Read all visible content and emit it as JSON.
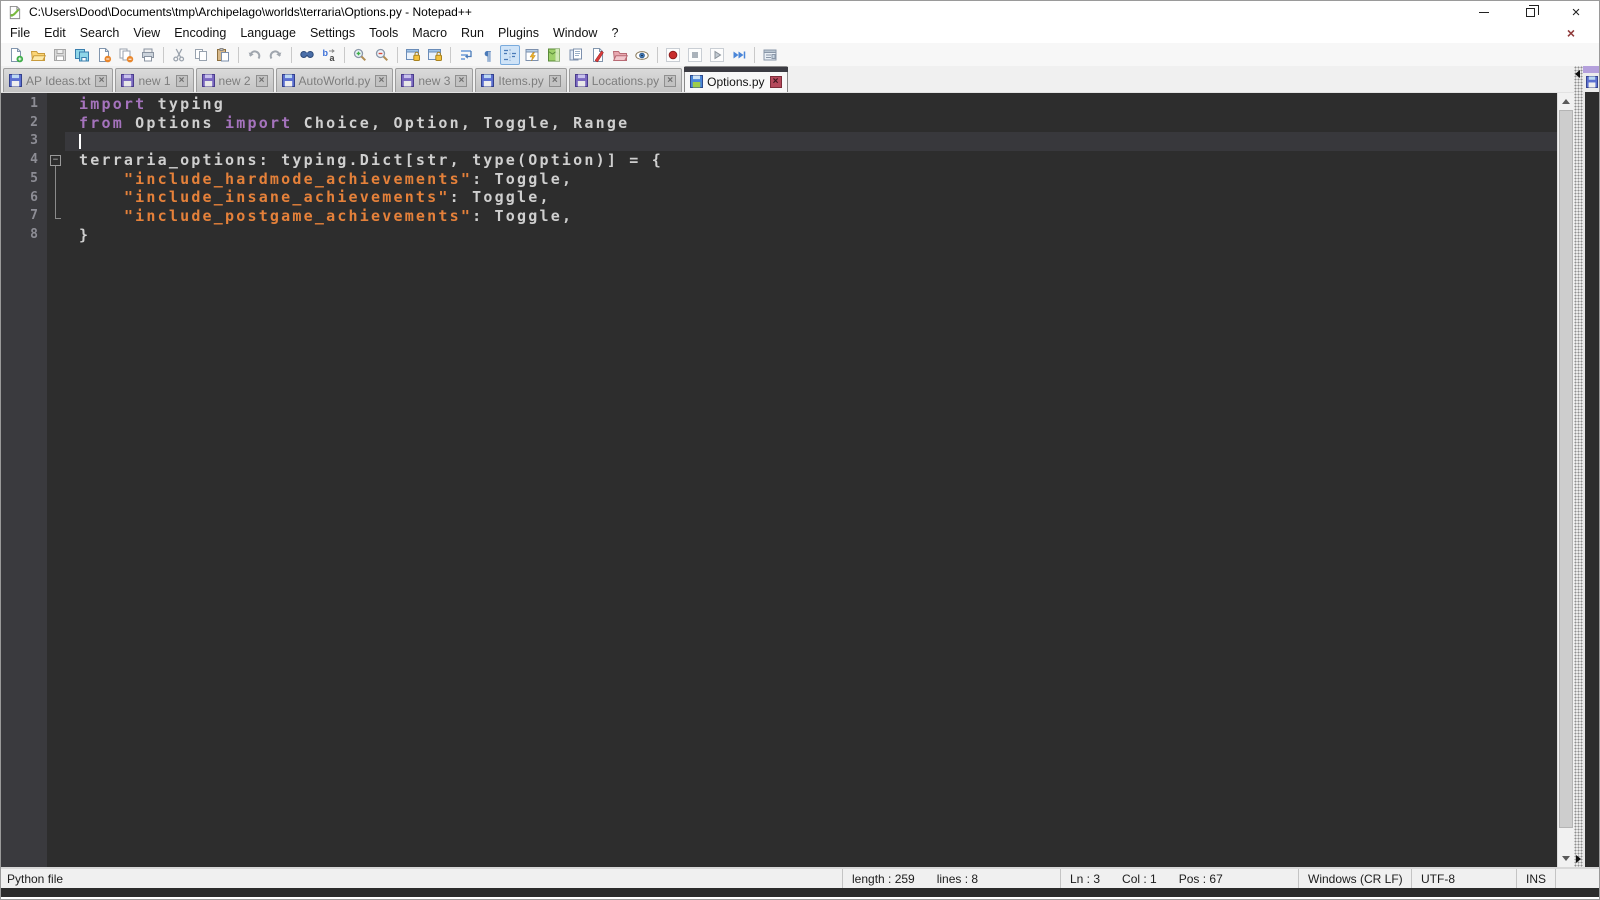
{
  "window": {
    "title": "C:\\Users\\Dood\\Documents\\tmp\\Archipelago\\worlds\\terraria\\Options.py - Notepad++",
    "controls": [
      "minimize",
      "restore",
      "close"
    ]
  },
  "menu": {
    "items": [
      "File",
      "Edit",
      "Search",
      "View",
      "Encoding",
      "Language",
      "Settings",
      "Tools",
      "Macro",
      "Run",
      "Plugins",
      "Window",
      "?"
    ],
    "doc_close_x": "×"
  },
  "toolbar": {
    "items": [
      "new-file",
      "open-file",
      "save-file",
      "save-all",
      "close-file",
      "close-all",
      "print",
      "sep",
      "cut",
      "copy",
      "paste",
      "sep",
      "undo",
      "redo",
      "sep",
      "find",
      "replace",
      "sep",
      "zoom-in",
      "zoom-out",
      "sep",
      "sync-vertical-scroll",
      "sync-horizontal-scroll",
      "sep",
      "word-wrap",
      "show-all-characters",
      "indent-guide",
      "function-list",
      "document-map",
      "document-list",
      "monitoring",
      "project-panel",
      "view-file",
      "sep",
      "macro-record",
      "macro-stop",
      "macro-play",
      "macro-run-multiple",
      "sep",
      "settings-panel"
    ],
    "pressed": [
      "indent-guide"
    ]
  },
  "tabs": [
    {
      "label": "AP Ideas.txt",
      "active": false,
      "icon": "blue"
    },
    {
      "label": "new 1",
      "active": false,
      "icon": "purple"
    },
    {
      "label": "new 2",
      "active": false,
      "icon": "purple"
    },
    {
      "label": "AutoWorld.py",
      "active": false,
      "icon": "blue"
    },
    {
      "label": "new 3",
      "active": false,
      "icon": "purple"
    },
    {
      "label": "Items.py",
      "active": false,
      "icon": "blue"
    },
    {
      "label": "Locations.py",
      "active": false,
      "icon": "purple"
    },
    {
      "label": "Options.py",
      "active": true,
      "icon": "green"
    }
  ],
  "editor": {
    "current_line": 3,
    "caret": {
      "line": 3,
      "col": 1
    },
    "lines": [
      {
        "num": "1",
        "fold": "",
        "segs": [
          [
            "kw",
            "import"
          ],
          [
            "df",
            " typing"
          ]
        ]
      },
      {
        "num": "2",
        "fold": "",
        "segs": [
          [
            "kw",
            "from"
          ],
          [
            "df",
            " Options "
          ],
          [
            "kw",
            "import"
          ],
          [
            "df",
            " Choice, Option, Toggle, Range"
          ]
        ]
      },
      {
        "num": "3",
        "fold": "",
        "segs": []
      },
      {
        "num": "4",
        "fold": "start",
        "segs": [
          [
            "df",
            "terraria_options: typing.Dict[str, type(Option)] = {"
          ]
        ]
      },
      {
        "num": "5",
        "fold": "mid",
        "segs": [
          [
            "df",
            "    "
          ],
          [
            "st",
            "\"include_hardmode_achievements\""
          ],
          [
            "df",
            ": Toggle,"
          ]
        ]
      },
      {
        "num": "6",
        "fold": "mid",
        "segs": [
          [
            "df",
            "    "
          ],
          [
            "st",
            "\"include_insane_achievements\""
          ],
          [
            "df",
            ": Toggle,"
          ]
        ]
      },
      {
        "num": "7",
        "fold": "end",
        "segs": [
          [
            "df",
            "    "
          ],
          [
            "st",
            "\"include_postgame_achievements\""
          ],
          [
            "df",
            ": Toggle,"
          ]
        ]
      },
      {
        "num": "8",
        "fold": "",
        "segs": [
          [
            "df",
            "}"
          ]
        ]
      }
    ],
    "colors": {
      "background": "#2d2d2d",
      "gutter_background": "#3a3a3e",
      "current_line_background": "#38383c",
      "keyword": "#a573bd",
      "string": "#e5813a",
      "default_text": "#cfcfcf",
      "line_number": "#8d8d95"
    }
  },
  "status": {
    "doc_type": "Python file",
    "length_label": "length : 259",
    "lines_label": "lines : 8",
    "ln_label": "Ln : 3",
    "col_label": "Col : 1",
    "pos_label": "Pos : 67",
    "eol": "Windows (CR LF)",
    "encoding": "UTF-8",
    "insert_mode": "INS"
  }
}
